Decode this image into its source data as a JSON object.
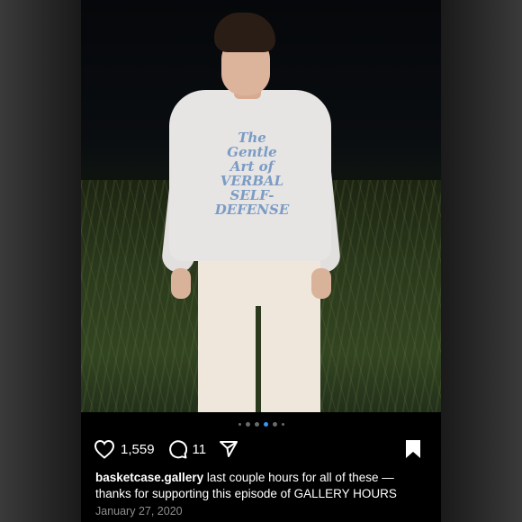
{
  "post": {
    "likes": "1,559",
    "comments": "11",
    "username": "basketcase.gallery",
    "caption_line1": "last couple hours for all of these —",
    "caption_line2": "thanks for supporting this episode of GALLERY HOURS",
    "date": "January 27, 2020",
    "shirt_text": [
      "The",
      "Gentle",
      "Art of",
      "VERBAL",
      "SELF-",
      "DEFENSE"
    ],
    "carousel": {
      "count": 6,
      "active_index": 3
    }
  },
  "colors": {
    "accent": "#3897f0",
    "muted": "#8e8e8e",
    "background": "#000000"
  },
  "icons": [
    "heart-icon",
    "comment-icon",
    "share-icon",
    "bookmark-icon"
  ]
}
